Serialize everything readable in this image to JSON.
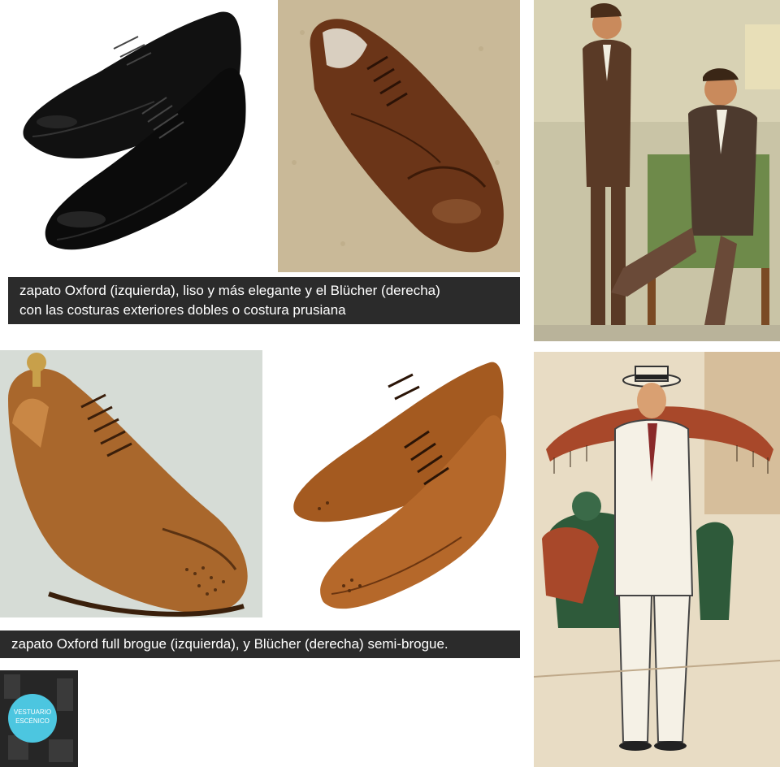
{
  "captions": {
    "top_line1": "zapato Oxford (izquierda), liso y más elegante y el Blücher (derecha)",
    "top_line2": "con las costuras exteriores dobles o costura prusiana",
    "bottom": "zapato Oxford  full brogue (izquierda), y Blücher (derecha) semi-brogue."
  },
  "logo": {
    "line1": "VESTUARIO",
    "line2": "ESCÉNICO"
  },
  "images": [
    {
      "name": "black-oxford-shoes-photo",
      "subject": "pair of black cap-toe Oxford shoes"
    },
    {
      "name": "brown-blucher-shoe-photo",
      "subject": "brown leather Blücher shoe on carpet"
    },
    {
      "name": "vintage-men-illustration",
      "subject": "two men in 1920s suits, one seated smoking"
    },
    {
      "name": "tan-full-brogue-shoe-photo",
      "subject": "tan full brogue Oxford shoe with shoe tree"
    },
    {
      "name": "brown-semi-brogue-shoes-photo",
      "subject": "pair of brown semi-brogue Blücher shoes"
    },
    {
      "name": "man-white-suit-illustration",
      "subject": "man in white suit and straw boater hat"
    }
  ],
  "colors": {
    "caption_bg": "#2b2b2b",
    "caption_text": "#ffffff",
    "logo_circle": "#4cc6e0"
  }
}
